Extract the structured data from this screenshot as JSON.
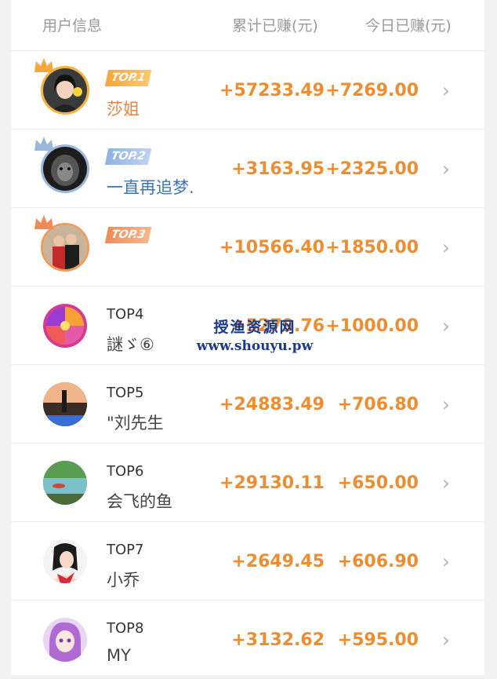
{
  "header": {
    "user_info": "用户信息",
    "total_earned": "累计已赚(元)",
    "today_earned": "今日已赚(元)"
  },
  "colors": {
    "amount": "#ee8d2f",
    "gold": "#f6b23a",
    "silver": "#9bb7dc",
    "bronze": "#f09a5a"
  },
  "rows": [
    {
      "rank": "TOP.1",
      "name": "莎姐",
      "total": "+57233.49",
      "today": "+7269.00",
      "style": "gold"
    },
    {
      "rank": "TOP.2",
      "name": "一直再追梦.",
      "total": "+3163.95",
      "today": "+2325.00",
      "style": "silver"
    },
    {
      "rank": "TOP.3",
      "name": "",
      "total": "+10566.40",
      "today": "+1850.00",
      "style": "bronze"
    },
    {
      "rank": "TOP4",
      "name": "謎ゞ⑥",
      "total": "+5279.76",
      "today": "+1000.00",
      "style": "plain"
    },
    {
      "rank": "TOP5",
      "name": "\"刘先生",
      "total": "+24883.49",
      "today": "+706.80",
      "style": "plain"
    },
    {
      "rank": "TOP6",
      "name": "会飞的鱼",
      "total": "+29130.11",
      "today": "+650.00",
      "style": "plain"
    },
    {
      "rank": "TOP7",
      "name": "小乔",
      "total": "+2649.45",
      "today": "+606.90",
      "style": "plain"
    },
    {
      "rank": "TOP8",
      "name": "MY",
      "total": "+3132.62",
      "today": "+595.00",
      "style": "plain"
    }
  ],
  "chevron": "›",
  "watermark": {
    "title": "授渔资源网",
    "url": "www.shouyu.pw"
  }
}
